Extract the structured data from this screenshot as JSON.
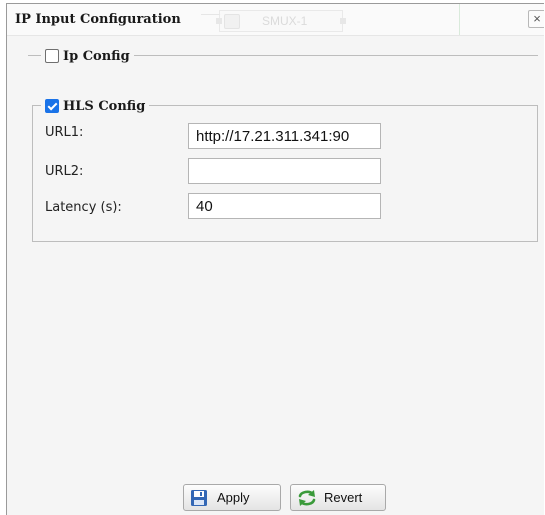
{
  "dialog": {
    "title": "IP Input Configuration",
    "close_glyph": "×",
    "background_node_label": "SMUX-1"
  },
  "ip_config": {
    "label": "Ip Config",
    "checked": false
  },
  "hls_config": {
    "label": "HLS Config",
    "checked": true,
    "fields": [
      {
        "label": "URL1:",
        "value": "http://17.21.311.341:90"
      },
      {
        "label": "URL2:",
        "value": ""
      },
      {
        "label": "Latency (s):",
        "value": "40"
      }
    ]
  },
  "buttons": {
    "apply_label": "Apply",
    "apply_icon": "save-icon",
    "revert_label": "Revert",
    "revert_icon": "revert-icon"
  },
  "colors": {
    "checkbox_accent": "#1a73e8",
    "revert_icon": "#3a9a3a",
    "save_icon": "#3367b5"
  }
}
